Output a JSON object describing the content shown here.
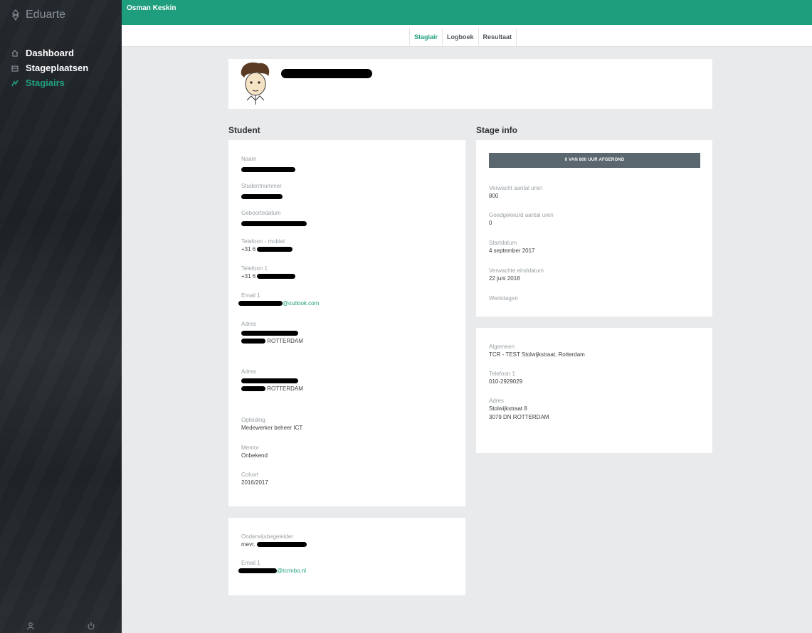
{
  "app": {
    "name": "Eduarte"
  },
  "topbar": {
    "user_name": "Osman Keskin"
  },
  "sidebar": {
    "items": [
      {
        "label": "Dashboard",
        "icon": "home-icon",
        "active": false
      },
      {
        "label": "Stageplaatsen",
        "icon": "building-icon",
        "active": false
      },
      {
        "label": "Stagiairs",
        "icon": "graduation-icon",
        "active": true
      }
    ],
    "bottom_icons": [
      "user-icon",
      "power-icon"
    ]
  },
  "tabs": [
    {
      "label": "Stagiair",
      "active": true
    },
    {
      "label": "Logboek",
      "active": false
    },
    {
      "label": "Resultaat",
      "active": false
    }
  ],
  "student": {
    "title": "Student",
    "naam_label": "Naam",
    "studentnummer_label": "Studentnummer",
    "geboortedatum_label": "Geboortedatum",
    "telefoon_mobiel_label": "Telefoon - mobiel",
    "telefoon_mobiel_prefix": "+31 6",
    "telefoon1_label": "Telefoon 1",
    "telefoon1_prefix": "+31 6",
    "email1_label": "Email 1",
    "email1_domain": "@outlook.com",
    "adres1_label": "Adres",
    "adres1_city": "ROTTERDAM",
    "adres2_label": "Adres",
    "adres2_city": "ROTTERDAM",
    "opleiding_label": "Opleiding",
    "opleiding_value": "Medewerker beheer ICT",
    "mentor_label": "Mentor",
    "mentor_value": "Onbekend",
    "cohort_label": "Cohort",
    "cohort_value": "2016/2017"
  },
  "begeleider": {
    "label": "Onderwijsbegeleider",
    "prefix": "mevr.",
    "email_label": "Email 1",
    "email_domain": "@tcrmbo.nl"
  },
  "stage_info": {
    "title": "Stage info",
    "progress_text": "0 VAN 800 UUR AFGEROND",
    "progress_fraction": 0,
    "verwacht_label": "Verwacht aantal uren",
    "verwacht_value": "800",
    "goedgekeurd_label": "Goedgekeurd aantal uren",
    "goedgekeurd_value": "0",
    "startdatum_label": "Startdatum",
    "startdatum_value": "4 september 2017",
    "einddatum_label": "Verwachte einddatum",
    "einddatum_value": "22 juni 2018",
    "werkdagen_label": "Werkdagen"
  },
  "company": {
    "algemeen_label": "Algemeen",
    "algemeen_value": "TCR - TEST Stolwijkstraat, Rotterdam",
    "telefoon_label": "Telefoon 1",
    "telefoon_value": "010-2929029",
    "adres_label": "Adres",
    "adres_line1": "Stolwijkstraat 8",
    "adres_line2": "3079 DN  ROTTERDAM"
  },
  "colors": {
    "accent": "#1f9e7e",
    "sidebar": "#22282c",
    "progress": "#5a676e",
    "background": "#e8eaeb"
  }
}
